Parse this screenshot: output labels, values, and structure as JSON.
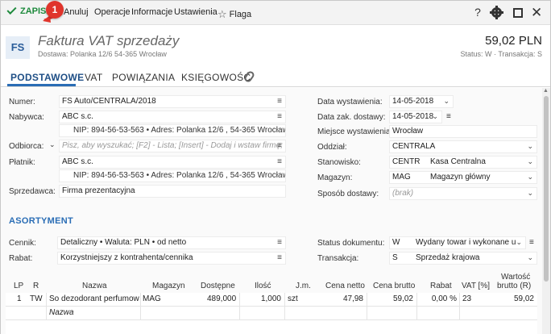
{
  "toolbar": {
    "save_label": "ZAPISZ",
    "badge": "1",
    "cancel_label": "Anuluj",
    "operations_label": "Operacje",
    "info_label": "Informacje",
    "settings_label": "Ustawienia",
    "flag_label": "Flaga",
    "help_label": "?"
  },
  "header": {
    "doc_code": "FS",
    "title": "Faktura VAT sprzedaży",
    "delivery": "Dostawa: Polanka  12/6  54-365 Wrocław",
    "amount": "59,02 PLN",
    "status_line": "Status: W  ·  Transakcja: S"
  },
  "tabs": [
    "PODSTAWOWE",
    "VAT",
    "POWIĄZANIA",
    "KSIĘGOWOŚĆ"
  ],
  "left": {
    "numer_label": "Numer:",
    "numer_value": "FS Auto/CENTRALA/2018",
    "nabywca_label": "Nabywca:",
    "nabywca_value": "ABC s.c.",
    "nabywca_details": "NIP: 894-56-53-563  •  Adres: Polanka  12/6 , 54-365 Wrocław",
    "odbiorca_label": "Odbiorca:",
    "odbiorca_placeholder": "Pisz, aby wyszukać; [F2] - Lista; [Insert] - Dodaj i wstaw firmę;",
    "platnik_label": "Płatnik:",
    "platnik_value": "ABC s.c.",
    "platnik_details": "NIP: 894-56-53-563  •  Adres: Polanka  12/6 , 54-365 Wrocław",
    "sprzedawca_label": "Sprzedawca:",
    "sprzedawca_value": "Firma prezentacyjna"
  },
  "right": {
    "data_wyst_label": "Data wystawienia:",
    "data_wyst_value": "14-05-2018",
    "data_zak_label": "Data zak. dostawy:",
    "data_zak_value": "14-05-2018",
    "miejsce_label": "Miejsce wystawienia:",
    "miejsce_value": "Wrocław",
    "oddzial_label": "Oddział:",
    "oddzial_value": "CENTRALA",
    "stanowisko_label": "Stanowisko:",
    "stanowisko_code": "CENTR",
    "stanowisko_name": "Kasa Centralna",
    "magazyn_label": "Magazyn:",
    "magazyn_code": "MAG",
    "magazyn_name": "Magazyn główny",
    "sposob_label": "Sposób dostawy:",
    "sposob_placeholder": "(brak)"
  },
  "asortyment": {
    "title": "ASORTYMENT",
    "cennik_label": "Cennik:",
    "cennik_value": "Detaliczny • Waluta: PLN • od netto",
    "rabat_label": "Rabat:",
    "rabat_value": "Korzystniejszy z kontrahenta/cennika",
    "status_label": "Status dokumentu:",
    "status_code": "W",
    "status_name": "Wydany towar i wykonane usługi",
    "transakcja_label": "Transakcja:",
    "transakcja_code": "S",
    "transakcja_name": "Sprzedaż krajowa"
  },
  "table": {
    "headers": [
      "LP",
      "R",
      "Nazwa",
      "Magazyn",
      "Dostępne",
      "Ilość",
      "J.m.",
      "Cena netto",
      "Cena brutto",
      "Rabat",
      "VAT [%]",
      "Wartość",
      "brutto (R)"
    ],
    "row": {
      "lp": "1",
      "r": "TW",
      "nazwa": "So dezodorant perfumow...",
      "magazyn": "MAG",
      "dostepne": "489,000",
      "ilosc": "1,000",
      "jm": "szt",
      "cena_netto": "47,98",
      "cena_brutto": "59,02",
      "rabat": "0,00 %",
      "vat": "23",
      "wartosc": "59,02"
    },
    "new_row_placeholder": "Nazwa"
  }
}
